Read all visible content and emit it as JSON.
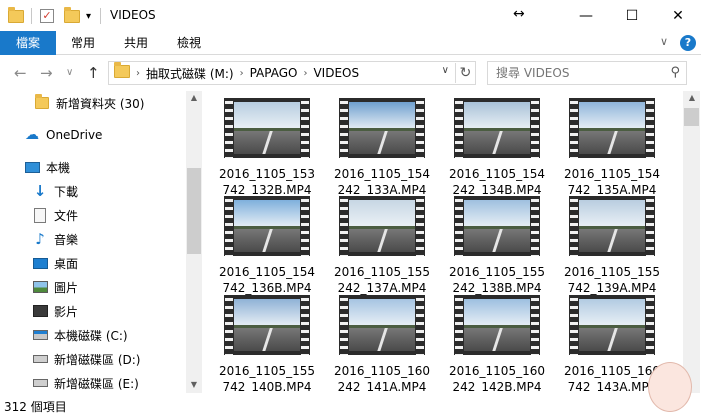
{
  "window": {
    "title": "VIDEOS",
    "resize_glyph": "↔",
    "min_glyph": "—",
    "max_glyph": "☐",
    "close_glyph": "✕"
  },
  "ribbon": {
    "tabs": [
      "檔案",
      "常用",
      "共用",
      "檢視"
    ],
    "chevron": "∨",
    "help": "?"
  },
  "address": {
    "crumbs": [
      "抽取式磁碟 (M:)",
      "PAPAGO",
      "VIDEOS"
    ],
    "separator": "›",
    "chevron": "∨",
    "refresh": "↻"
  },
  "search": {
    "placeholder": "搜尋 VIDEOS"
  },
  "nav": {
    "back": "←",
    "forward": "→",
    "recent": "∨",
    "up": "↑",
    "items": [
      {
        "label": "新增資料夾 (30)",
        "icon": "folder-icon"
      },
      {
        "label": "OneDrive",
        "icon": "onedrive-icon"
      },
      {
        "label": "本機",
        "icon": "computer-icon"
      },
      {
        "label": "下載",
        "icon": "download-icon"
      },
      {
        "label": "文件",
        "icon": "document-icon"
      },
      {
        "label": "音樂",
        "icon": "music-icon"
      },
      {
        "label": "桌面",
        "icon": "desktop-icon"
      },
      {
        "label": "圖片",
        "icon": "pictures-icon"
      },
      {
        "label": "影片",
        "icon": "video-icon"
      },
      {
        "label": "本機磁碟 (C:)",
        "icon": "drive-icon"
      },
      {
        "label": "新增磁碟區 (D:)",
        "icon": "drive-icon"
      },
      {
        "label": "新增磁碟區 (E:)",
        "icon": "drive-icon"
      }
    ]
  },
  "files": [
    {
      "line1": "2016_1105_153",
      "line2": "742_132B.MP4",
      "sky": "#b7cde0"
    },
    {
      "line1": "2016_1105_154",
      "line2": "242_133A.MP4",
      "sky": "#6fa0cf"
    },
    {
      "line1": "2016_1105_154",
      "line2": "242_134B.MP4",
      "sky": "#a9c2d8"
    },
    {
      "line1": "2016_1105_154",
      "line2": "742_135A.MP4",
      "sky": "#8fb5da"
    },
    {
      "line1": "2016_1105_154",
      "line2": "742_136B.MP4",
      "sky": "#7fb0dc"
    },
    {
      "line1": "2016_1105_155",
      "line2": "242_137A.MP4",
      "sky": "#c7d6e4"
    },
    {
      "line1": "2016_1105_155",
      "line2": "242_138B.MP4",
      "sky": "#9fc0df"
    },
    {
      "line1": "2016_1105_155",
      "line2": "742_139A.MP4",
      "sky": "#b9cde0"
    },
    {
      "line1": "2016_1105_155",
      "line2": "742_140B.MP4",
      "sky": "#8fb2d6"
    },
    {
      "line1": "2016_1105_160",
      "line2": "242_141A.MP4",
      "sky": "#a6c4e2"
    },
    {
      "line1": "2016_1105_160",
      "line2": "242_142B.MP4",
      "sky": "#9dbfe0"
    },
    {
      "line1": "2016_1105_160",
      "line2": "742_143A.MP4",
      "sky": "#b2cbe2"
    }
  ],
  "status": {
    "count": "312 個項目"
  },
  "colors": {
    "accent": "#1979ca"
  }
}
